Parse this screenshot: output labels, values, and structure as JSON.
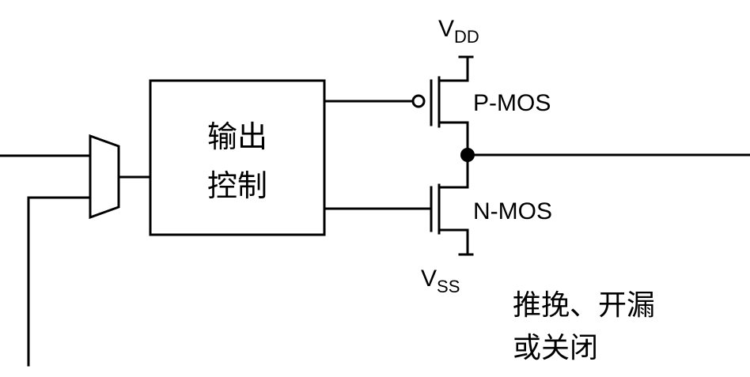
{
  "control_block": {
    "line1": "输出",
    "line2": "控制"
  },
  "vdd": {
    "main": "V",
    "sub": "DD"
  },
  "vss": {
    "main": "V",
    "sub": "SS"
  },
  "pmos_label": "P-MOS",
  "nmos_label": "N-MOS",
  "mode_text": {
    "line1": "推挽、开漏",
    "line2": "或关闭"
  }
}
